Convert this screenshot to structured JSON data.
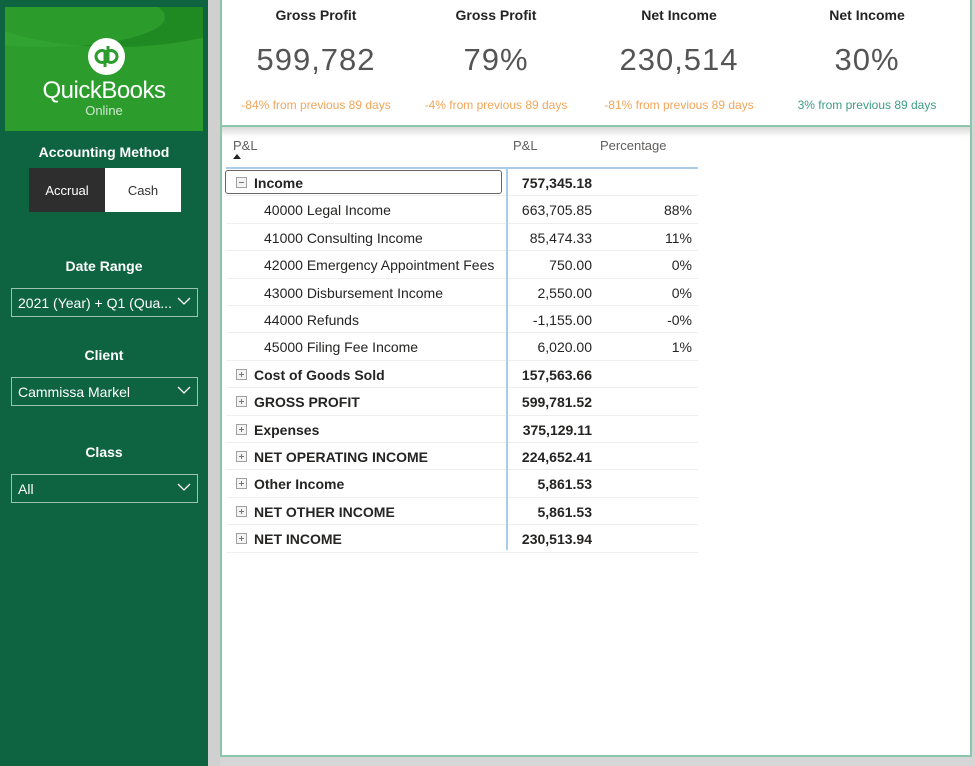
{
  "sidebar": {
    "logo": {
      "brand": "QuickBooks",
      "sub": "Online",
      "mark": "qb"
    },
    "accounting_method": {
      "label": "Accounting Method",
      "options": [
        "Accrual",
        "Cash"
      ],
      "selected": "Accrual"
    },
    "date_range": {
      "label": "Date Range",
      "value": "2021 (Year) + Q1 (Qua..."
    },
    "client": {
      "label": "Client",
      "value": "Cammissa Markel"
    },
    "class": {
      "label": "Class",
      "value": "All"
    }
  },
  "kpis": [
    {
      "title": "Gross Profit",
      "value": "599,782",
      "delta": "-84% from previous 89 days",
      "delta_color": "#f2a65a"
    },
    {
      "title": "Gross Profit",
      "value": "79%",
      "delta": "-4% from previous 89 days",
      "delta_color": "#f2a65a"
    },
    {
      "title": "Net Income",
      "value": "230,514",
      "delta": "-81% from previous 89 days",
      "delta_color": "#f2a65a"
    },
    {
      "title": "Net Income",
      "value": "30%",
      "delta": "3% from previous 89 days",
      "delta_color": "#3e9c84"
    }
  ],
  "table": {
    "headers": {
      "label": "P&L",
      "amount": "P&L",
      "percentage": "Percentage"
    },
    "rows": [
      {
        "label": "Income",
        "amount": "757,345.18",
        "pct": "",
        "level": 0,
        "expanded": true
      },
      {
        "label": "40000 Legal Income",
        "amount": "663,705.85",
        "pct": "88%",
        "level": 1
      },
      {
        "label": "41000 Consulting Income",
        "amount": "85,474.33",
        "pct": "11%",
        "level": 1
      },
      {
        "label": "42000 Emergency Appointment Fees",
        "amount": "750.00",
        "pct": "0%",
        "level": 1
      },
      {
        "label": "43000 Disbursement Income",
        "amount": "2,550.00",
        "pct": "0%",
        "level": 1
      },
      {
        "label": "44000 Refunds",
        "amount": "-1,155.00",
        "pct": "-0%",
        "level": 1
      },
      {
        "label": "45000 Filing Fee Income",
        "amount": "6,020.00",
        "pct": "1%",
        "level": 1
      },
      {
        "label": "Cost of Goods Sold",
        "amount": "157,563.66",
        "pct": "",
        "level": 0,
        "expanded": false
      },
      {
        "label": "GROSS PROFIT",
        "amount": "599,781.52",
        "pct": "",
        "level": 0,
        "expanded": false
      },
      {
        "label": "Expenses",
        "amount": "375,129.11",
        "pct": "",
        "level": 0,
        "expanded": false
      },
      {
        "label": "NET OPERATING INCOME",
        "amount": "224,652.41",
        "pct": "",
        "level": 0,
        "expanded": false
      },
      {
        "label": "Other Income",
        "amount": "5,861.53",
        "pct": "",
        "level": 0,
        "expanded": false
      },
      {
        "label": "NET OTHER INCOME",
        "amount": "5,861.53",
        "pct": "",
        "level": 0,
        "expanded": false
      },
      {
        "label": "NET INCOME",
        "amount": "230,513.94",
        "pct": "",
        "level": 0,
        "expanded": false
      }
    ]
  }
}
